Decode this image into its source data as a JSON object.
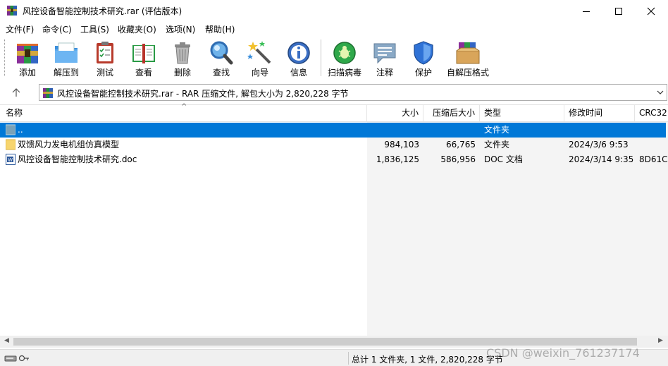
{
  "window": {
    "title": "风控设备智能控制技术研究.rar (评估版本)",
    "app_icon": "winrar-icon"
  },
  "menu": [
    "文件(F)",
    "命令(C)",
    "工具(S)",
    "收藏夹(O)",
    "选项(N)",
    "帮助(H)"
  ],
  "toolbar": [
    {
      "label": "添加",
      "icon": "add-archive-icon"
    },
    {
      "label": "解压到",
      "icon": "extract-folder-icon"
    },
    {
      "label": "测试",
      "icon": "test-clipboard-icon"
    },
    {
      "label": "查看",
      "icon": "view-book-icon"
    },
    {
      "label": "删除",
      "icon": "trash-icon"
    },
    {
      "label": "查找",
      "icon": "magnifier-icon"
    },
    {
      "label": "向导",
      "icon": "wizard-wand-icon"
    },
    {
      "label": "信息",
      "icon": "info-icon"
    },
    {
      "label": "扫描病毒",
      "icon": "virus-scan-icon"
    },
    {
      "label": "注释",
      "icon": "comment-icon"
    },
    {
      "label": "保护",
      "icon": "shield-icon"
    },
    {
      "label": "自解压格式",
      "icon": "sfx-box-icon"
    }
  ],
  "address": {
    "text": "风控设备智能控制技术研究.rar - RAR 压缩文件, 解包大小为 2,820,228 字节"
  },
  "columns": [
    "名称",
    "大小",
    "压缩后大小",
    "类型",
    "修改时间",
    "CRC32"
  ],
  "rows": [
    {
      "name": "..",
      "size": "",
      "packed": "",
      "type": "文件夹",
      "modified": "",
      "crc": "",
      "selected": true,
      "icon": "parent-folder-icon"
    },
    {
      "name": "双馈风力发电机组仿真模型",
      "size": "984,103",
      "packed": "66,765",
      "type": "文件夹",
      "modified": "2024/3/6 9:53",
      "crc": "",
      "selected": false,
      "icon": "folder-icon"
    },
    {
      "name": "风控设备智能控制技术研究.doc",
      "size": "1,836,125",
      "packed": "586,956",
      "type": "DOC 文档",
      "modified": "2024/3/14 9:35",
      "crc": "8D61C",
      "selected": false,
      "icon": "word-doc-icon"
    }
  ],
  "status": {
    "text": "总计 1 文件夹, 1 文件, 2,820,228 字节"
  },
  "watermark": "CSDN @weixin_761237174",
  "colors": {
    "selection": "#0078d7",
    "window_bg": "#ffffff",
    "status_bg": "#f0f0f0"
  }
}
